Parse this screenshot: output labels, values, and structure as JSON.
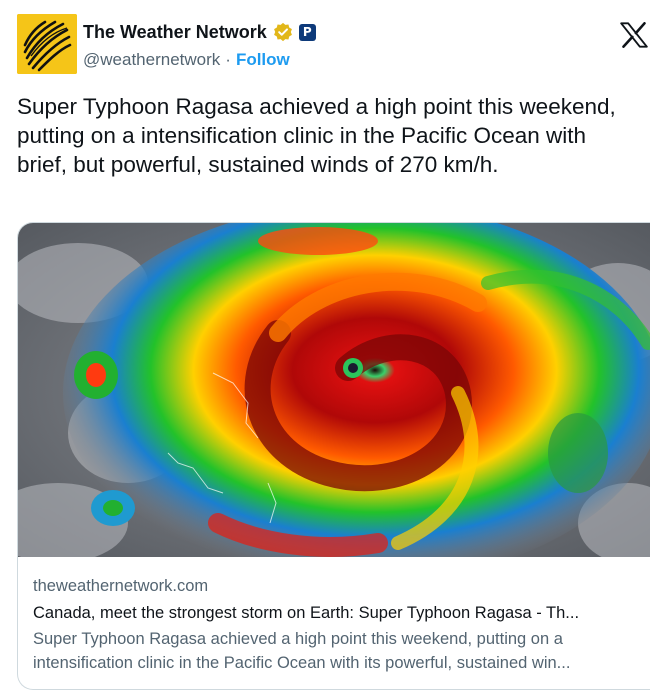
{
  "account": {
    "display_name": "The Weather Network",
    "handle": "@weathernetwork",
    "separator": "·",
    "follow_label": "Follow",
    "badge_letter": "P",
    "avatar_icon": "weather-network-globe-logo",
    "verified_icon": "gold-verified-badge-icon"
  },
  "tweet": {
    "text": "Super Typhoon Ragasa achieved a high point this weekend, putting on a intensification clinic in the Pacific Ocean with brief, but powerful, sustained winds of 270 km/h."
  },
  "card": {
    "image_description_icon": "typhoon-satellite-image",
    "domain": "theweathernetwork.com",
    "title": "Canada, meet the strongest storm on Earth: Super Typhoon Ragasa - Th...",
    "description": "Super Typhoon Ragasa achieved a high point this weekend, putting on a intensification clinic in the Pacific Ocean with its powerful, sustained win..."
  },
  "colors": {
    "link_blue": "#1d9bf0",
    "secondary_text": "#536471",
    "avatar_yellow": "#f5c518",
    "verified_gold": "#e2b719"
  }
}
